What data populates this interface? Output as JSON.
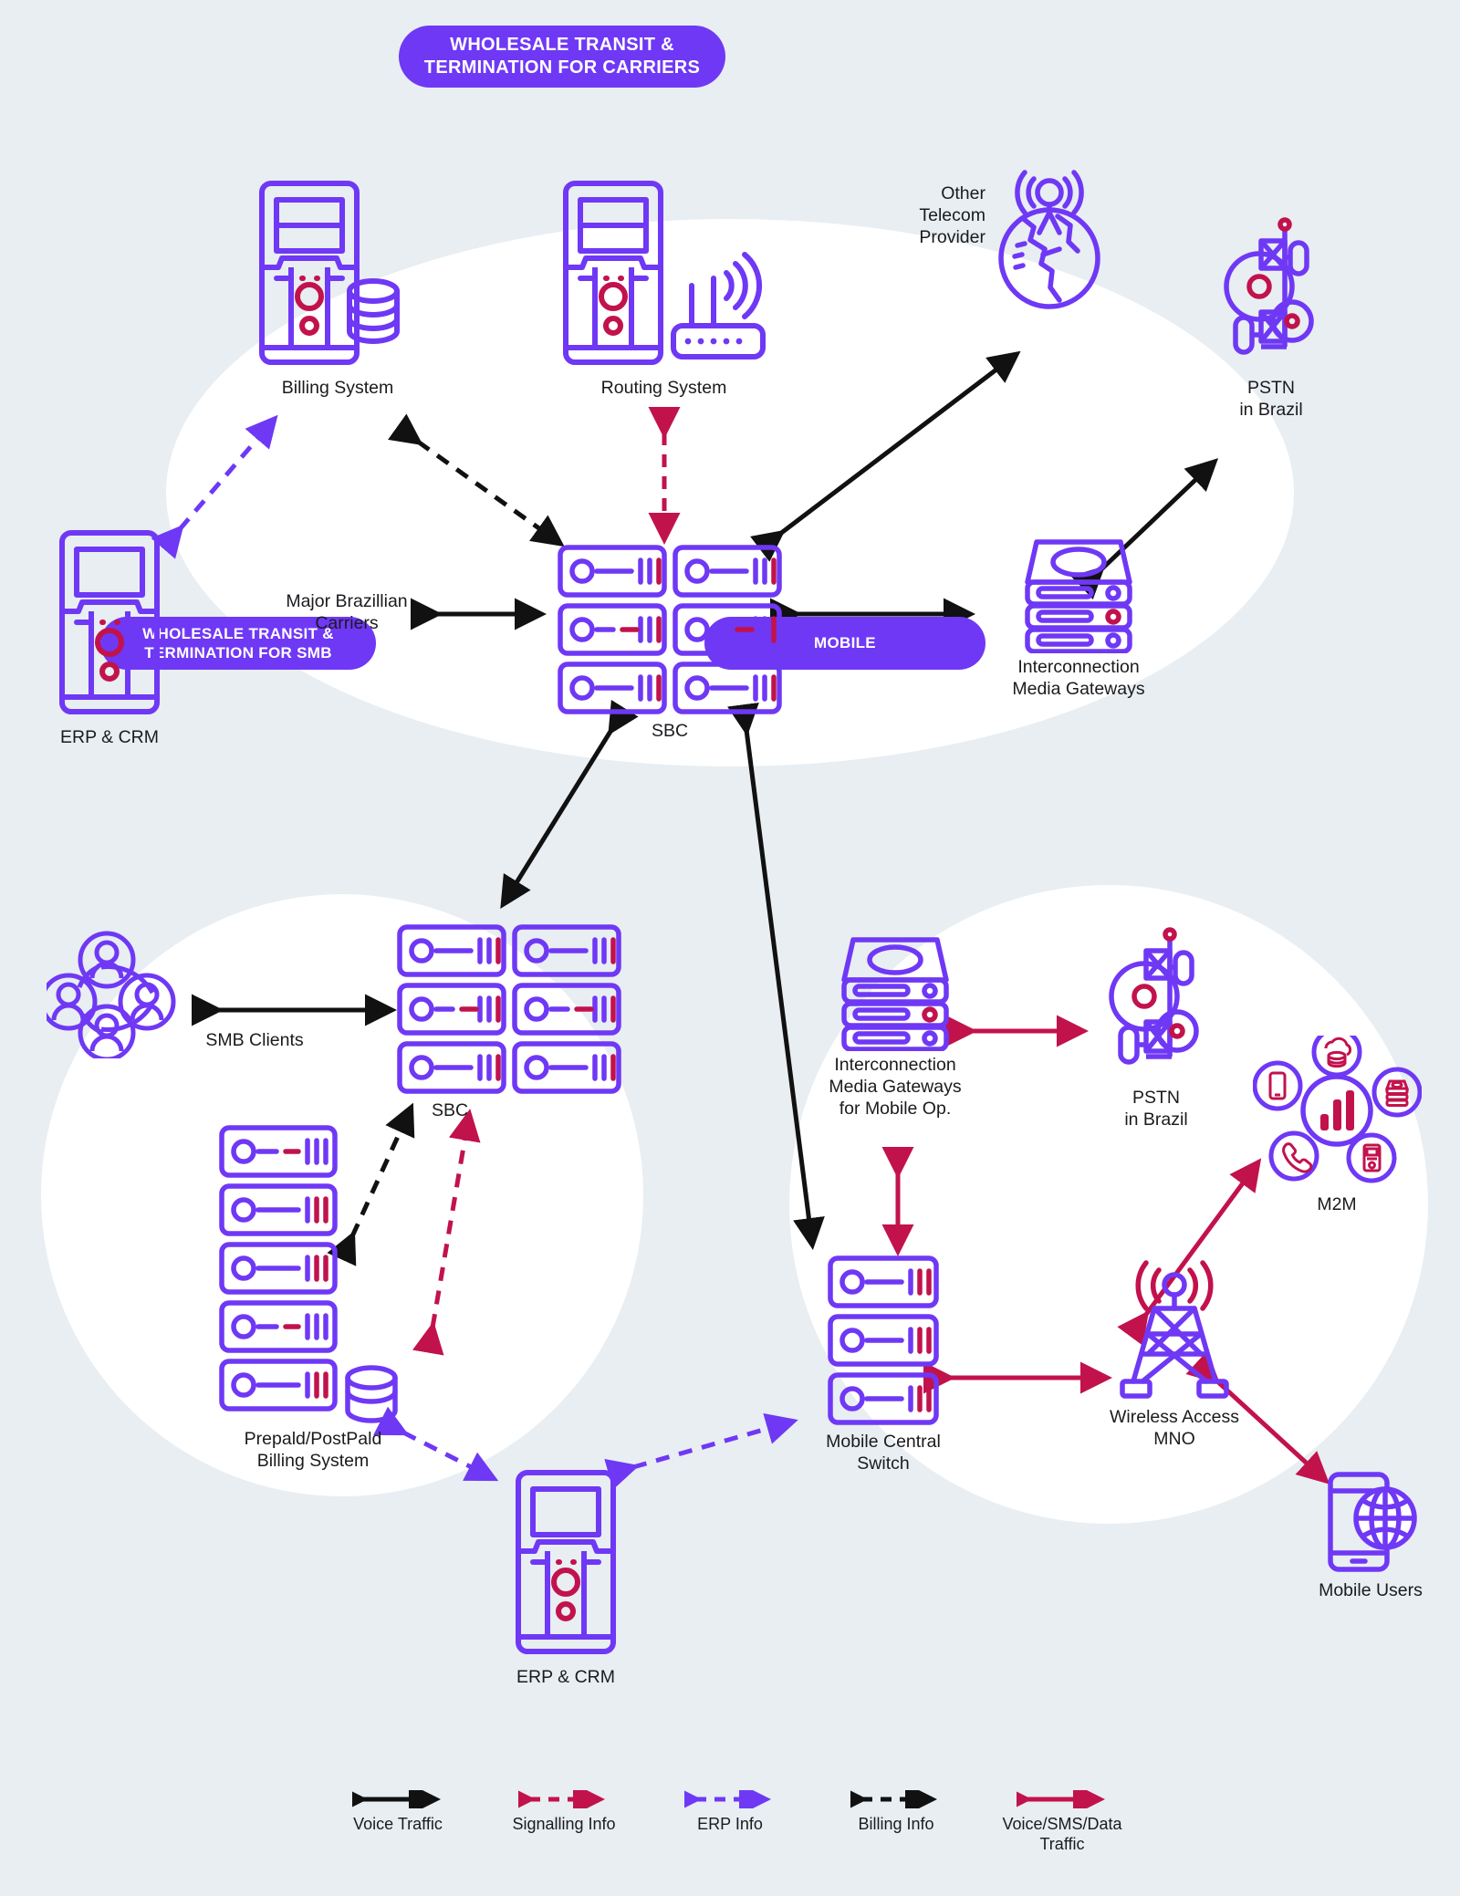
{
  "page": {
    "background_color": "#e8eef2",
    "bubble_color": "#ffffff",
    "purple": "#6f38f5",
    "crimson": "#c2124c",
    "black": "#111111",
    "text_color": "#1b1b1f"
  },
  "banners": {
    "carriers": "WHOLESALE TRANSIT &\nTERMINATION FOR CARRIERS",
    "smb": "WHOLESALE TRANSIT &\nTERMINATION FOR SMB",
    "mobile": "MOBILE"
  },
  "nodes": {
    "billing_system": "Billing System",
    "routing_system": "Routing System",
    "other_telecom_provider": "Other\nTelecom\nProvider",
    "pstn_brazil_top": "PSTN\nin Brazil",
    "erp_crm_top": "ERP & CRM",
    "major_brazilian_carriers": "Major Brazillian\nCarriers",
    "sbc_top": "SBC",
    "interconnection_media_gateways": "Interconnection\nMedia Gateways",
    "smb_clients": "SMB Clients",
    "sbc_smb": "SBC",
    "prepaid_billing_system": "Prepald/PostPald\nBilling System",
    "erp_crm_bottom": "ERP & CRM",
    "interconnection_media_gateways_mobile": "Interconnection\nMedia Gateways\nfor Mobile Op.",
    "pstn_brazil_mobile": "PSTN\nin Brazil",
    "mobile_central_switch": "Mobile Central\nSwitch",
    "wireless_access_mno": "Wireless Access\nMNO",
    "m2m": "M2M",
    "mobile_users": "Mobile Users"
  },
  "legend": [
    {
      "label": "Voice Traffic",
      "color": "#111111",
      "style": "solid",
      "icon": "double-arrow-solid-black"
    },
    {
      "label": "Signalling Info",
      "color": "#c2124c",
      "style": "dashed",
      "icon": "double-arrow-dashed-crimson"
    },
    {
      "label": "ERP Info",
      "color": "#6f38f5",
      "style": "dashed",
      "icon": "double-arrow-dashed-purple"
    },
    {
      "label": "Billing Info",
      "color": "#111111",
      "style": "dashed",
      "icon": "double-arrow-dashed-black"
    },
    {
      "label": "Voice/SMS/Data\nTraffic",
      "color": "#c2124c",
      "style": "solid",
      "icon": "double-arrow-solid-crimson"
    }
  ],
  "connections": [
    {
      "from": "erp_crm_top",
      "to": "billing_system",
      "type": "ERP Info"
    },
    {
      "from": "billing_system",
      "to": "sbc_top",
      "type": "Billing Info"
    },
    {
      "from": "routing_system",
      "to": "sbc_top",
      "type": "Signalling Info"
    },
    {
      "from": "major_brazilian_carriers",
      "to": "sbc_top",
      "type": "Voice Traffic"
    },
    {
      "from": "sbc_top",
      "to": "other_telecom_provider",
      "type": "Voice Traffic"
    },
    {
      "from": "sbc_top",
      "to": "interconnection_media_gateways",
      "type": "Voice Traffic"
    },
    {
      "from": "interconnection_media_gateways",
      "to": "pstn_brazil_top",
      "type": "Voice Traffic"
    },
    {
      "from": "sbc_top",
      "to": "sbc_smb",
      "type": "Voice Traffic"
    },
    {
      "from": "sbc_top",
      "to": "mobile_central_switch",
      "type": "Voice Traffic"
    },
    {
      "from": "smb_clients",
      "to": "sbc_smb",
      "type": "Voice Traffic"
    },
    {
      "from": "prepaid_billing_system",
      "to": "sbc_smb",
      "type": "Billing Info"
    },
    {
      "from": "prepaid_billing_system",
      "to": "sbc_smb",
      "type": "Signalling Info"
    },
    {
      "from": "prepaid_billing_system",
      "to": "erp_crm_bottom",
      "type": "ERP Info"
    },
    {
      "from": "erp_crm_bottom",
      "to": "mobile_central_switch",
      "type": "ERP Info"
    },
    {
      "from": "interconnection_media_gateways_mobile",
      "to": "pstn_brazil_mobile",
      "type": "Voice/SMS/Data Traffic"
    },
    {
      "from": "interconnection_media_gateways_mobile",
      "to": "mobile_central_switch",
      "type": "Voice/SMS/Data Traffic"
    },
    {
      "from": "mobile_central_switch",
      "to": "wireless_access_mno",
      "type": "Voice/SMS/Data Traffic"
    },
    {
      "from": "wireless_access_mno",
      "to": "m2m",
      "type": "Voice/SMS/Data Traffic"
    },
    {
      "from": "wireless_access_mno",
      "to": "mobile_users",
      "type": "Voice/SMS/Data Traffic"
    }
  ]
}
